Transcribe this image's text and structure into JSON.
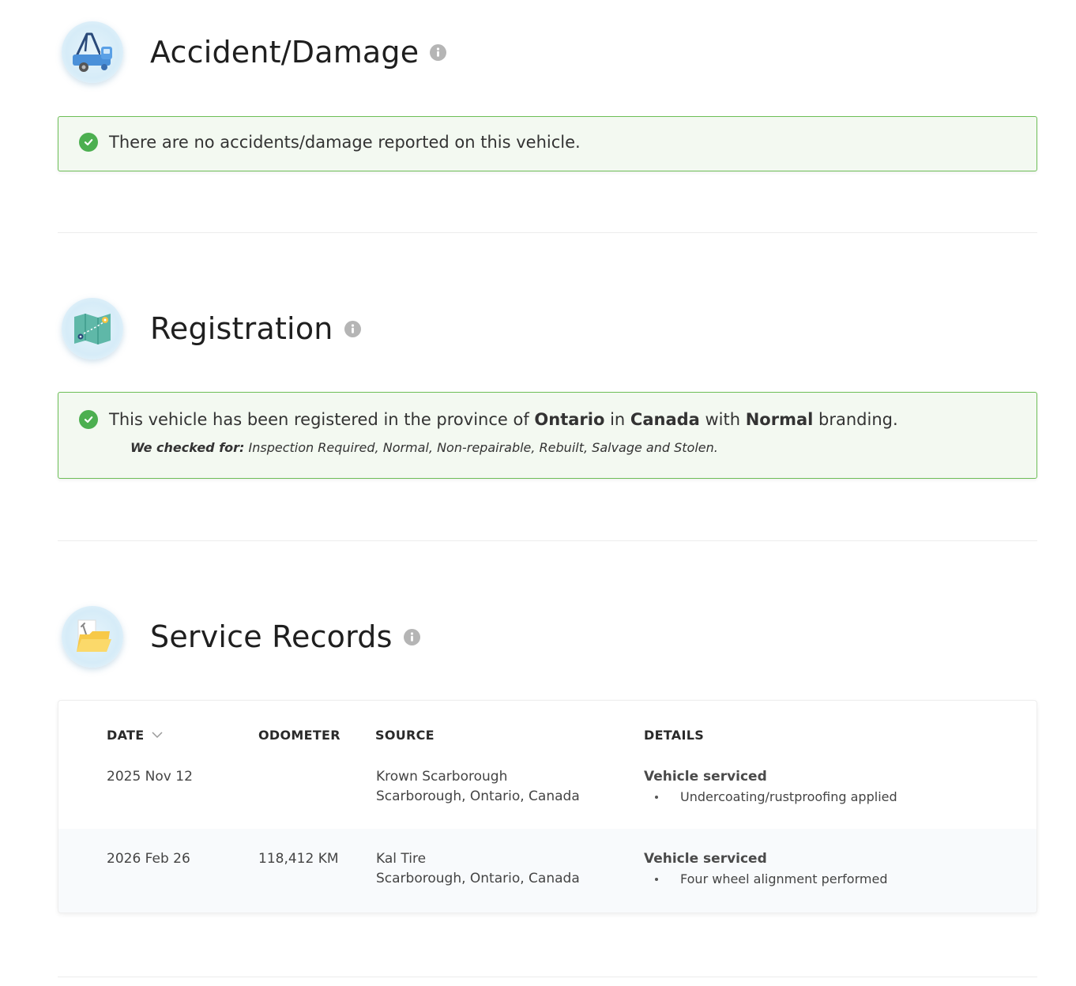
{
  "accident": {
    "title": "Accident/Damage",
    "icon": "tow-truck-icon",
    "message": "There are no accidents/damage reported on this vehicle."
  },
  "registration": {
    "title": "Registration",
    "icon": "map-icon",
    "message_prefix": "This vehicle has been registered in the province of ",
    "province": "Ontario",
    "message_mid": " in ",
    "country": "Canada",
    "message_mid2": " with ",
    "branding": "Normal",
    "message_suffix": " branding.",
    "checked_label": "We checked for:",
    "checked_list": " Inspection Required, Normal, Non-repairable, Rebuilt, Salvage and Stolen."
  },
  "service": {
    "title": "Service Records",
    "icon": "folder-icon",
    "columns": {
      "date": "DATE",
      "odometer": "ODOMETER",
      "source": "SOURCE",
      "details": "DETAILS"
    },
    "rows": [
      {
        "date": "2025 Nov 12",
        "odometer": "",
        "source_name": "Krown Scarborough",
        "source_location": "Scarborough, Ontario, Canada",
        "detail_title": "Vehicle serviced",
        "detail_item": "Undercoating/rustproofing applied"
      },
      {
        "date": "2026 Feb 26",
        "odometer": "118,412 KM",
        "source_name": "Kal Tire",
        "source_location": "Scarborough, Ontario, Canada",
        "detail_title": "Vehicle serviced",
        "detail_item": "Four wheel alignment performed"
      }
    ]
  },
  "colors": {
    "success_green": "#4caf50",
    "alert_border": "#6dbe57",
    "alert_bg": "#f3f9f1"
  }
}
